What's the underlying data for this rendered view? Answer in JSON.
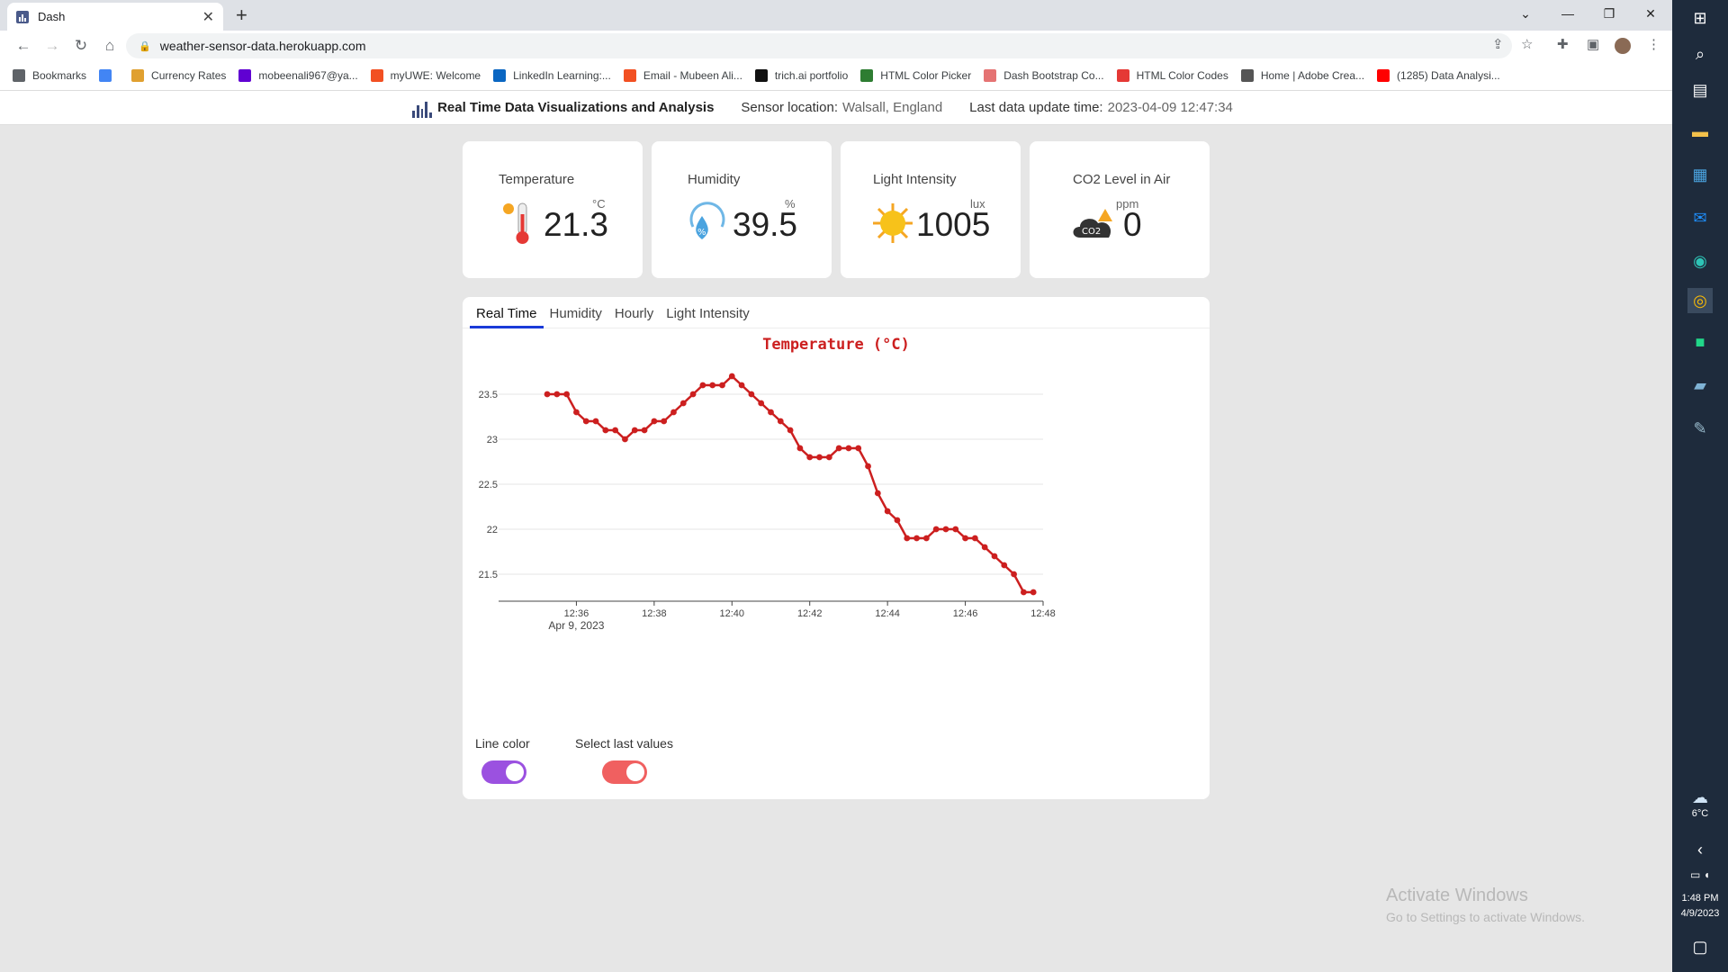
{
  "browser": {
    "tab_title": "Dash",
    "url": "weather-sensor-data.herokuapp.com",
    "bookmarks": [
      {
        "label": "Bookmarks",
        "color": "#5f6368"
      },
      {
        "label": "",
        "color": "#4285f4"
      },
      {
        "label": "Currency Rates",
        "color": "#e0a030"
      },
      {
        "label": "mobeenali967@ya...",
        "color": "#6001d2"
      },
      {
        "label": "myUWE: Welcome",
        "color": "#f25022"
      },
      {
        "label": "LinkedIn Learning:...",
        "color": "#0a66c2"
      },
      {
        "label": "Email - Mubeen Ali...",
        "color": "#f25022"
      },
      {
        "label": "trich.ai portfolio",
        "color": "#111111"
      },
      {
        "label": "HTML Color Picker",
        "color": "#2e7d32"
      },
      {
        "label": "Dash Bootstrap Co...",
        "color": "#e57373"
      },
      {
        "label": "HTML Color Codes",
        "color": "#e53935"
      },
      {
        "label": "Home | Adobe Crea...",
        "color": "#555555"
      },
      {
        "label": "(1285) Data Analysi...",
        "color": "#ff0000"
      }
    ]
  },
  "header": {
    "title": "Real Time Data Visualizations and Analysis",
    "location_label": "Sensor location:",
    "location_value": "Walsall, England",
    "update_label": "Last data update time:",
    "update_value": "2023-04-09 12:47:34"
  },
  "cards": {
    "temperature": {
      "title": "Temperature",
      "unit": "°C",
      "value": "21.3"
    },
    "humidity": {
      "title": "Humidity",
      "unit": "%",
      "value": "39.5"
    },
    "light": {
      "title": "Light Intensity",
      "unit": "lux",
      "value": "1005"
    },
    "co2": {
      "title": "CO2 Level in Air",
      "unit": "ppm",
      "value": "0"
    }
  },
  "tabs": [
    "Real Time",
    "Humidity",
    "Hourly",
    "Light Intensity"
  ],
  "controls": {
    "line_color_label": "Line color",
    "select_last_label": "Select last values",
    "line_color_toggle_color": "#9b51e0",
    "select_last_toggle_color": "#f06060"
  },
  "chart_data": {
    "type": "line",
    "title": "Temperature (°C)",
    "line_color": "#cc1f1f",
    "x_tick_labels": [
      "12:36",
      "12:38",
      "12:40",
      "12:42",
      "12:44",
      "12:46",
      "12:48"
    ],
    "x_date_label": "Apr 9, 2023",
    "y_tick_labels": [
      "23.5",
      "23",
      "22.5",
      "22",
      "21.5"
    ],
    "ylim": [
      21.25,
      23.75
    ],
    "x_minutes_range": [
      34.0,
      48.0
    ],
    "series": [
      {
        "x": [
          35.25,
          35.5,
          35.75,
          36.0,
          36.25,
          36.5,
          36.75,
          37.0,
          37.25,
          37.5,
          37.75,
          38.0,
          38.25,
          38.5,
          38.75,
          39.0,
          39.25,
          39.5,
          39.75,
          40.0,
          40.25,
          40.5,
          40.75,
          41.0,
          41.25,
          41.5,
          41.75,
          42.0,
          42.25,
          42.5,
          42.75,
          43.0,
          43.25,
          43.5,
          43.75,
          44.0,
          44.25,
          44.5,
          44.75,
          45.0,
          45.25,
          45.5,
          45.75,
          46.0,
          46.25,
          46.5,
          46.75,
          47.0,
          47.25,
          47.5,
          47.75
        ],
        "y": [
          23.5,
          23.5,
          23.5,
          23.3,
          23.2,
          23.2,
          23.1,
          23.1,
          23.0,
          23.1,
          23.1,
          23.2,
          23.2,
          23.3,
          23.4,
          23.5,
          23.6,
          23.6,
          23.6,
          23.7,
          23.6,
          23.5,
          23.4,
          23.3,
          23.2,
          23.1,
          22.9,
          22.8,
          22.8,
          22.8,
          22.9,
          22.9,
          22.9,
          22.7,
          22.4,
          22.2,
          22.1,
          21.9,
          21.9,
          21.9,
          22.0,
          22.0,
          22.0,
          21.9,
          21.9,
          21.8,
          21.7,
          21.6,
          21.5,
          21.3,
          21.3
        ]
      }
    ]
  },
  "activate": {
    "line1": "Activate Windows",
    "line2": "Go to Settings to activate Windows."
  },
  "taskbar": {
    "weather_temp": "6°C",
    "time": "1:48 PM",
    "date": "4/9/2023"
  }
}
